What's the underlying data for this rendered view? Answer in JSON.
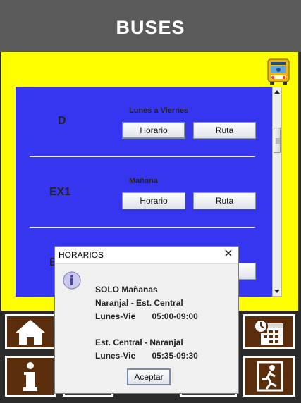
{
  "header": {
    "title": "BUSES"
  },
  "routes": [
    {
      "code": "D",
      "schedule_label": "Lunes a Viernes",
      "horario_label": "Horario",
      "ruta_label": "Ruta"
    },
    {
      "code": "EX1",
      "schedule_label": "Mañana",
      "horario_label": "Horario",
      "ruta_label": "Ruta"
    },
    {
      "code": "E"
    }
  ],
  "icons": {
    "bus": "bus-icon",
    "home": "home-icon",
    "calendar": "calendar-clock-icon",
    "info": "info-icon",
    "exit": "exit-icon",
    "dialog_info": "info-circle-icon"
  },
  "colors": {
    "panel_blue": "#3636f0",
    "background_yellow": "#ffff00",
    "tile_brown": "#5a2d0c"
  },
  "dialog": {
    "title": "HORARIOS",
    "lines": [
      "SOLO Mañanas",
      "Naranjal - Est. Central",
      "Lunes-Vie       05:00-09:00",
      "Est. Central - Naranjal",
      "Lunes-Vie       05:35-09:30"
    ],
    "ok_label": "Aceptar"
  }
}
